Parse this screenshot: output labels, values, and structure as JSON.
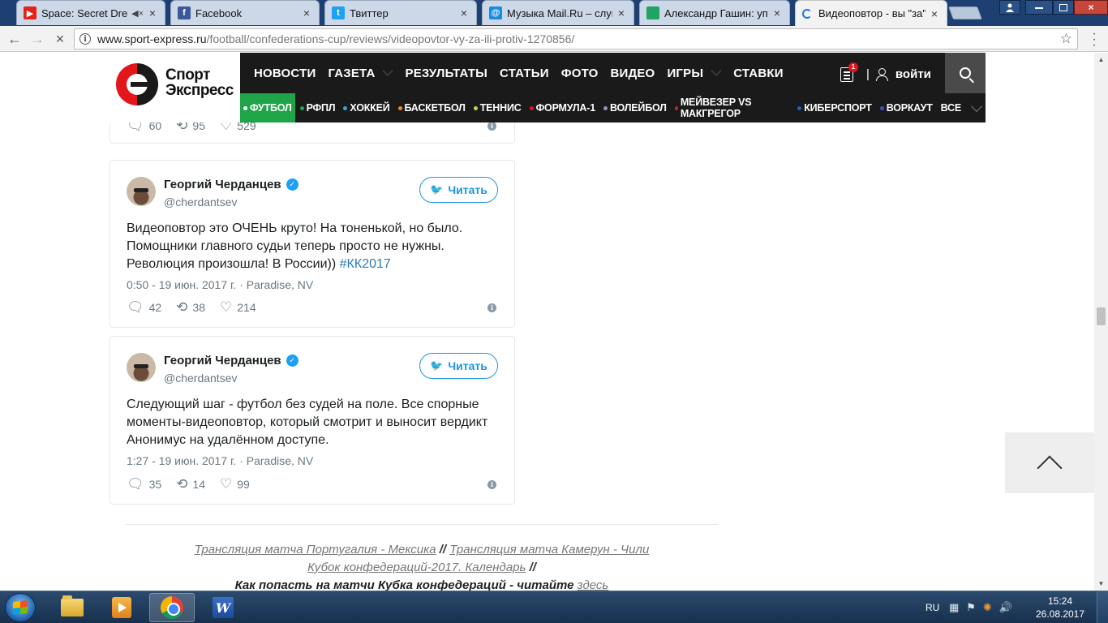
{
  "browser": {
    "tabs": [
      {
        "title": "Space: Secret Dreams",
        "icon": "youtube-icon",
        "muted": true
      },
      {
        "title": "Facebook",
        "icon": "facebook-icon"
      },
      {
        "title": "Твиттер",
        "icon": "twitter-icon"
      },
      {
        "title": "Музыка Mail.Ru – слуша",
        "icon": "mailru-icon"
      },
      {
        "title": "Александр Гашин: упра",
        "icon": "sheet-icon"
      },
      {
        "title": "Видеоповтор - вы \"за\" и",
        "icon": "loading-icon",
        "active": true
      }
    ],
    "url_host": "www.sport-express.ru",
    "url_path": "/football/confederations-cup/reviews/videopovtor-vy-za-ili-protiv-1270856/"
  },
  "site": {
    "logo_line1": "Спорт",
    "logo_line2": "Экспресс",
    "menu": [
      {
        "label": "НОВОСТИ"
      },
      {
        "label": "ГАЗЕТА",
        "has_dropdown": true
      },
      {
        "label": "РЕЗУЛЬТАТЫ"
      },
      {
        "label": "СТАТЬИ"
      },
      {
        "label": "ФОТО"
      },
      {
        "label": "ВИДЕО"
      },
      {
        "label": "ИГРЫ",
        "has_dropdown": true
      },
      {
        "label": "СТАВКИ"
      }
    ],
    "notifications_count": "1",
    "login_label": "войти",
    "submenu": [
      {
        "label": "ФУТБОЛ",
        "dot": "#ffffff",
        "active": true
      },
      {
        "label": "РФПЛ",
        "dot": "#1fa547"
      },
      {
        "label": "ХОККЕЙ",
        "dot": "#3ba3e0"
      },
      {
        "label": "БАСКЕТБОЛ",
        "dot": "#f08a1c"
      },
      {
        "label": "ТЕННИС",
        "dot": "#c7d64a"
      },
      {
        "label": "ФОРМУЛА-1",
        "dot": "#e2161b"
      },
      {
        "label": "ВОЛЕЙБОЛ",
        "dot": "#9b8fc7"
      },
      {
        "label": "МЕЙВЕЗЕР VS МАКГРЕГОР",
        "dot": "#c1272d"
      },
      {
        "label": "КИБЕРСПОРТ",
        "dot": "#3556c8"
      },
      {
        "label": "ВОРКАУТ",
        "dot": "#3556c8"
      },
      {
        "label": "ВСЕ"
      }
    ]
  },
  "tweet_top": {
    "replies": "60",
    "retweets": "95",
    "likes": "529"
  },
  "tweets": [
    {
      "author": "Георгий Черданцев",
      "handle": "@cherdantsev",
      "follow_label": "Читать",
      "text": "Видеоповтор это ОЧЕНЬ круто! На тоненькой, но было. Помощники главного судьи теперь просто не нужны. Революция произошла! В России)) ",
      "hashtag": "#КК2017",
      "meta": "0:50 - 19 июн. 2017 г. · Paradise, NV",
      "replies": "42",
      "retweets": "38",
      "likes": "214"
    },
    {
      "author": "Георгий Черданцев",
      "handle": "@cherdantsev",
      "follow_label": "Читать",
      "text": "Следующий шаг - футбол без судей на поле. Все спорные моменты-видеоповтор, который смотрит и выносит вердикт Анонимус на удалённом доступе.",
      "hashtag": "",
      "meta": "1:27 - 19 июн. 2017 г. · Paradise, NV",
      "replies": "35",
      "retweets": "14",
      "likes": "99"
    }
  ],
  "links": {
    "link1": "Трансляция матча Португалия - Мексика",
    "sep": "//",
    "link2": "Трансляция матча Камерун - Чили",
    "link3": "Кубок конфедераций-2017. Календарь",
    "sep2": "//",
    "line3_text": "Как попасть на матчи Кубка конфедераций - читайте",
    "line3_link": "здесь"
  },
  "taskbar": {
    "lang": "RU",
    "time": "15:24",
    "date": "26.08.2017"
  }
}
